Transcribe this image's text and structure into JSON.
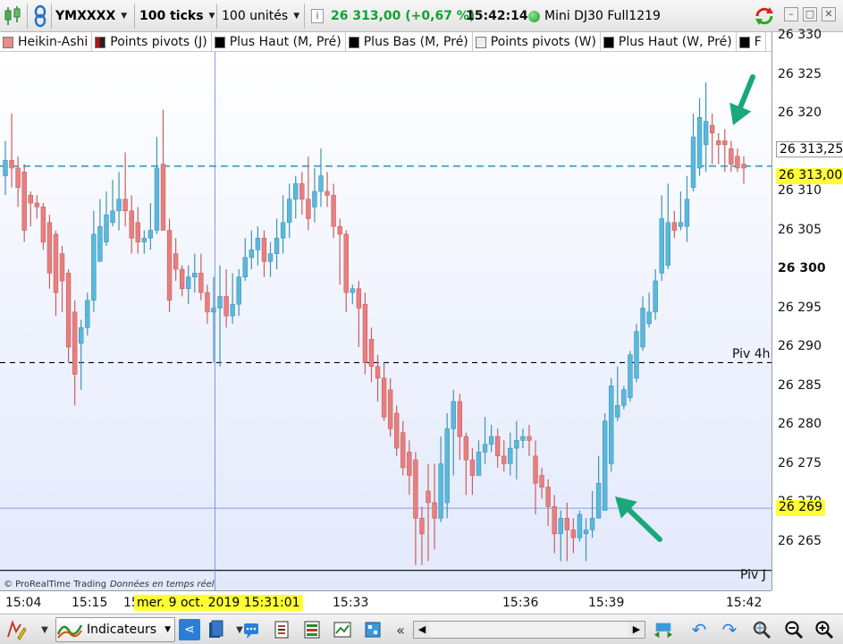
{
  "toolbar": {
    "symbol": "YMXXXX",
    "ticks": "100 ticks",
    "units": "100 unités",
    "price": "26 313,00",
    "change": "(+0,67 %)",
    "time": "15:42:14",
    "instrument": "Mini DJ30 Full1219"
  },
  "legend": [
    {
      "label": "Heikin-Ashi",
      "swatch": "#ea8a8a"
    },
    {
      "label": "Points pivots (J)",
      "swatch": "#222222"
    },
    {
      "label": "Plus Haut (M, Pré)",
      "swatch": "#000000"
    },
    {
      "label": "Plus Bas (M, Pré)",
      "swatch": "#000000"
    },
    {
      "label": "Points pivots (W)",
      "swatch": "#eeeeee"
    },
    {
      "label": "Plus Haut (W, Pré)",
      "swatch": "#000000"
    },
    {
      "label": "F",
      "swatch": "#000000"
    }
  ],
  "price_axis": {
    "ticks": [
      "26 330",
      "26 325",
      "26 320",
      "26 315",
      "26 310",
      "26 305",
      "26 300",
      "26 295",
      "26 290",
      "26 285",
      "26 280",
      "26 275",
      "26 270",
      "26 265"
    ],
    "bold_tick": "26 300",
    "last_price_label": "26 313,00",
    "ref_price_label": "26 313,25",
    "cursor_price_label": "26 269"
  },
  "time_axis": {
    "ticks": [
      "15:04",
      "15:15",
      "15",
      "15:33",
      "15:36",
      "15:39",
      "15:42"
    ],
    "cursor_label": "mer. 9 oct. 2019 15:31:01"
  },
  "pivot_labels": [
    "Piv 4h",
    "Piv J"
  ],
  "credit": {
    "source": "© ProRealTime Trading",
    "note": "Données en temps réel"
  },
  "bottombar": {
    "indicators_label": "Indicateurs"
  },
  "colors": {
    "up": "#5bb8dc",
    "down": "#e87f7f",
    "last_price_line": "#2a9bc8",
    "cursor_line": "#6a82e0",
    "arrow": "#1aa87a",
    "price_badge": "#ffff33"
  },
  "chart_data": {
    "type": "candlestick",
    "ylim": [
      26261,
      26331.5
    ],
    "reference_lines": [
      {
        "label": "",
        "value": 26313.25,
        "style": "dashed",
        "color": "#2a9bc8"
      },
      {
        "label": "Piv 4h",
        "value": 26288,
        "style": "dashed",
        "color": "#000000"
      },
      {
        "label": "Piv J",
        "value": 26261.3,
        "style": "solid",
        "color": "#000000"
      }
    ],
    "candles": [
      {
        "o": 26312.0,
        "h": 26316.5,
        "l": 26309.5,
        "c": 26314.0
      },
      {
        "o": 26314.0,
        "h": 26320.0,
        "l": 26310.5,
        "c": 26313.0
      },
      {
        "o": 26313.0,
        "h": 26314.5,
        "l": 26308.0,
        "c": 26310.5
      },
      {
        "o": 26312.5,
        "h": 26313.5,
        "l": 26303.5,
        "c": 26305.0
      },
      {
        "o": 26309.5,
        "h": 26310.0,
        "l": 26305.5,
        "c": 26308.5
      },
      {
        "o": 26308.5,
        "h": 26309.5,
        "l": 26306.5,
        "c": 26308.0
      },
      {
        "o": 26308.0,
        "h": 26308.5,
        "l": 26302.5,
        "c": 26303.5
      },
      {
        "o": 26306.0,
        "h": 26307.0,
        "l": 26297.5,
        "c": 26299.5
      },
      {
        "o": 26304.5,
        "h": 26305.0,
        "l": 26294.0,
        "c": 26297.0
      },
      {
        "o": 26302.0,
        "h": 26303.0,
        "l": 26294.5,
        "c": 26298.5
      },
      {
        "o": 26299.5,
        "h": 26300.0,
        "l": 26288.0,
        "c": 26290.0
      },
      {
        "o": 26294.5,
        "h": 26296.0,
        "l": 26282.5,
        "c": 26286.5
      },
      {
        "o": 26290.5,
        "h": 26293.5,
        "l": 26284.5,
        "c": 26292.5
      },
      {
        "o": 26292.5,
        "h": 26297.0,
        "l": 26291.5,
        "c": 26296.0
      },
      {
        "o": 26296.0,
        "h": 26307.5,
        "l": 26294.5,
        "c": 26304.5
      },
      {
        "o": 26301.0,
        "h": 26309.0,
        "l": 26301.0,
        "c": 26305.5
      },
      {
        "o": 26303.5,
        "h": 26310.0,
        "l": 26303.0,
        "c": 26307.0
      },
      {
        "o": 26306.0,
        "h": 26311.5,
        "l": 26305.5,
        "c": 26307.5
      },
      {
        "o": 26307.5,
        "h": 26312.5,
        "l": 26305.0,
        "c": 26309.0
      },
      {
        "o": 26309.0,
        "h": 26315.0,
        "l": 26305.5,
        "c": 26307.5
      },
      {
        "o": 26307.5,
        "h": 26309.5,
        "l": 26302.0,
        "c": 26304.0
      },
      {
        "o": 26306.0,
        "h": 26308.0,
        "l": 26302.0,
        "c": 26303.5
      },
      {
        "o": 26303.5,
        "h": 26305.0,
        "l": 26302.0,
        "c": 26304.0
      },
      {
        "o": 26304.0,
        "h": 26308.5,
        "l": 26302.5,
        "c": 26305.0
      },
      {
        "o": 26305.0,
        "h": 26317.0,
        "l": 26304.5,
        "c": 26313.0
      },
      {
        "o": 26313.5,
        "h": 26320.5,
        "l": 26305.0,
        "c": 26305.0
      },
      {
        "o": 26305.0,
        "h": 26306.5,
        "l": 26294.5,
        "c": 26296.0
      },
      {
        "o": 26302.0,
        "h": 26304.0,
        "l": 26298.5,
        "c": 26300.0
      },
      {
        "o": 26300.0,
        "h": 26300.5,
        "l": 26296.5,
        "c": 26297.5
      },
      {
        "o": 26297.5,
        "h": 26300.5,
        "l": 26295.5,
        "c": 26299.0
      },
      {
        "o": 26299.0,
        "h": 26302.0,
        "l": 26297.0,
        "c": 26299.5
      },
      {
        "o": 26299.5,
        "h": 26302.0,
        "l": 26296.0,
        "c": 26297.0
      },
      {
        "o": 26297.0,
        "h": 26298.0,
        "l": 26293.0,
        "c": 26294.5
      },
      {
        "o": 26294.5,
        "h": 26299.0,
        "l": 26288.0,
        "c": 26295.0
      },
      {
        "o": 26295.0,
        "h": 26300.5,
        "l": 26287.5,
        "c": 26296.5
      },
      {
        "o": 26296.5,
        "h": 26300.0,
        "l": 26292.5,
        "c": 26294.0
      },
      {
        "o": 26294.0,
        "h": 26299.5,
        "l": 26293.0,
        "c": 26295.5
      },
      {
        "o": 26295.5,
        "h": 26300.0,
        "l": 26294.0,
        "c": 26299.0
      },
      {
        "o": 26299.0,
        "h": 26304.0,
        "l": 26298.5,
        "c": 26301.5
      },
      {
        "o": 26301.5,
        "h": 26305.0,
        "l": 26300.0,
        "c": 26302.5
      },
      {
        "o": 26302.5,
        "h": 26305.5,
        "l": 26300.5,
        "c": 26304.0
      },
      {
        "o": 26304.0,
        "h": 26305.0,
        "l": 26299.0,
        "c": 26301.0
      },
      {
        "o": 26301.0,
        "h": 26303.5,
        "l": 26299.0,
        "c": 26302.0
      },
      {
        "o": 26302.0,
        "h": 26306.5,
        "l": 26300.0,
        "c": 26304.0
      },
      {
        "o": 26304.0,
        "h": 26309.5,
        "l": 26302.0,
        "c": 26306.0
      },
      {
        "o": 26306.0,
        "h": 26311.0,
        "l": 26304.0,
        "c": 26309.0
      },
      {
        "o": 26309.0,
        "h": 26312.0,
        "l": 26306.5,
        "c": 26311.0
      },
      {
        "o": 26311.0,
        "h": 26312.5,
        "l": 26307.0,
        "c": 26309.0
      },
      {
        "o": 26309.0,
        "h": 26314.5,
        "l": 26305.0,
        "c": 26306.5
      },
      {
        "o": 26308.0,
        "h": 26313.0,
        "l": 26306.0,
        "c": 26310.0
      },
      {
        "o": 26310.0,
        "h": 26315.5,
        "l": 26308.0,
        "c": 26312.0
      },
      {
        "o": 26310.0,
        "h": 26312.5,
        "l": 26308.0,
        "c": 26309.5
      },
      {
        "o": 26309.5,
        "h": 26311.0,
        "l": 26304.0,
        "c": 26305.5
      },
      {
        "o": 26305.5,
        "h": 26306.5,
        "l": 26298.0,
        "c": 26304.5
      },
      {
        "o": 26304.5,
        "h": 26305.0,
        "l": 26294.5,
        "c": 26297.0
      },
      {
        "o": 26297.0,
        "h": 26298.0,
        "l": 26295.5,
        "c": 26297.5
      },
      {
        "o": 26297.5,
        "h": 26298.5,
        "l": 26290.0,
        "c": 26295.0
      },
      {
        "o": 26295.5,
        "h": 26297.0,
        "l": 26286.5,
        "c": 26288.0
      },
      {
        "o": 26291.0,
        "h": 26292.5,
        "l": 26285.5,
        "c": 26287.5
      },
      {
        "o": 26287.5,
        "h": 26289.0,
        "l": 26283.0,
        "c": 26286.0
      },
      {
        "o": 26286.0,
        "h": 26288.0,
        "l": 26280.5,
        "c": 26281.0
      },
      {
        "o": 26284.5,
        "h": 26286.0,
        "l": 26278.5,
        "c": 26279.5
      },
      {
        "o": 26281.5,
        "h": 26282.5,
        "l": 26276.0,
        "c": 26277.0
      },
      {
        "o": 26279.0,
        "h": 26280.5,
        "l": 26273.5,
        "c": 26274.5
      },
      {
        "o": 26276.5,
        "h": 26278.0,
        "l": 26271.0,
        "c": 26273.5
      },
      {
        "o": 26275.5,
        "h": 26276.5,
        "l": 26262.0,
        "c": 26268.0
      },
      {
        "o": 26268.0,
        "h": 26269.5,
        "l": 26262.0,
        "c": 26266.0
      },
      {
        "o": 26271.5,
        "h": 26275.0,
        "l": 26262.5,
        "c": 26270.0
      },
      {
        "o": 26270.0,
        "h": 26275.0,
        "l": 26264.0,
        "c": 26268.0
      },
      {
        "o": 26268.0,
        "h": 26278.5,
        "l": 26267.5,
        "c": 26275.0
      },
      {
        "o": 26270.0,
        "h": 26281.5,
        "l": 26268.0,
        "c": 26279.5
      },
      {
        "o": 26279.5,
        "h": 26284.5,
        "l": 26273.5,
        "c": 26283.0
      },
      {
        "o": 26283.0,
        "h": 26284.0,
        "l": 26275.5,
        "c": 26278.5
      },
      {
        "o": 26278.5,
        "h": 26279.0,
        "l": 26271.0,
        "c": 26275.5
      },
      {
        "o": 26275.5,
        "h": 26277.0,
        "l": 26271.0,
        "c": 26273.5
      },
      {
        "o": 26273.5,
        "h": 26278.0,
        "l": 26273.5,
        "c": 26276.5
      },
      {
        "o": 26276.5,
        "h": 26281.0,
        "l": 26275.0,
        "c": 26277.5
      },
      {
        "o": 26277.5,
        "h": 26280.0,
        "l": 26276.5,
        "c": 26278.5
      },
      {
        "o": 26278.5,
        "h": 26279.5,
        "l": 26274.5,
        "c": 26276.0
      },
      {
        "o": 26276.0,
        "h": 26278.0,
        "l": 26274.0,
        "c": 26275.0
      },
      {
        "o": 26275.0,
        "h": 26279.0,
        "l": 26273.5,
        "c": 26277.0
      },
      {
        "o": 26277.0,
        "h": 26280.5,
        "l": 26273.0,
        "c": 26278.0
      },
      {
        "o": 26278.0,
        "h": 26279.5,
        "l": 26277.0,
        "c": 26278.5
      },
      {
        "o": 26278.5,
        "h": 26280.0,
        "l": 26276.0,
        "c": 26278.0
      },
      {
        "o": 26276.0,
        "h": 26278.0,
        "l": 26268.5,
        "c": 26272.5
      },
      {
        "o": 26273.5,
        "h": 26274.5,
        "l": 26270.5,
        "c": 26272.0
      },
      {
        "o": 26272.0,
        "h": 26273.0,
        "l": 26267.0,
        "c": 26269.5
      },
      {
        "o": 26269.5,
        "h": 26271.0,
        "l": 26263.5,
        "c": 26266.0
      },
      {
        "o": 26266.0,
        "h": 26269.0,
        "l": 26262.5,
        "c": 26268.0
      },
      {
        "o": 26268.0,
        "h": 26270.0,
        "l": 26262.5,
        "c": 26266.5
      },
      {
        "o": 26266.5,
        "h": 26268.0,
        "l": 26263.5,
        "c": 26265.5
      },
      {
        "o": 26265.5,
        "h": 26269.0,
        "l": 26265.0,
        "c": 26268.5
      },
      {
        "o": 26266.0,
        "h": 26268.0,
        "l": 26262.5,
        "c": 26266.5
      },
      {
        "o": 26266.5,
        "h": 26271.5,
        "l": 26265.5,
        "c": 26268.0
      },
      {
        "o": 26268.0,
        "h": 26276.0,
        "l": 26268.0,
        "c": 26272.5
      },
      {
        "o": 26269.0,
        "h": 26281.5,
        "l": 26269.0,
        "c": 26280.5
      },
      {
        "o": 26275.0,
        "h": 26286.0,
        "l": 26274.0,
        "c": 26285.0
      },
      {
        "o": 26281.0,
        "h": 26287.5,
        "l": 26280.5,
        "c": 26282.5
      },
      {
        "o": 26282.5,
        "h": 26285.0,
        "l": 26282.0,
        "c": 26284.5
      },
      {
        "o": 26283.5,
        "h": 26289.5,
        "l": 26283.0,
        "c": 26289.0
      },
      {
        "o": 26286.0,
        "h": 26293.0,
        "l": 26285.5,
        "c": 26292.0
      },
      {
        "o": 26290.0,
        "h": 26296.5,
        "l": 26289.5,
        "c": 26295.0
      },
      {
        "o": 26293.0,
        "h": 26297.0,
        "l": 26292.5,
        "c": 26294.5
      },
      {
        "o": 26294.5,
        "h": 26300.0,
        "l": 26293.5,
        "c": 26298.5
      },
      {
        "o": 26299.5,
        "h": 26309.5,
        "l": 26298.5,
        "c": 26306.5
      },
      {
        "o": 26300.5,
        "h": 26311.0,
        "l": 26300.0,
        "c": 26306.0
      },
      {
        "o": 26306.0,
        "h": 26307.5,
        "l": 26304.0,
        "c": 26305.0
      },
      {
        "o": 26305.5,
        "h": 26310.0,
        "l": 26305.0,
        "c": 26306.0
      },
      {
        "o": 26305.5,
        "h": 26312.0,
        "l": 26303.5,
        "c": 26309.0
      },
      {
        "o": 26310.5,
        "h": 26320.0,
        "l": 26310.0,
        "c": 26317.0
      },
      {
        "o": 26313.0,
        "h": 26322.0,
        "l": 26312.0,
        "c": 26319.5
      },
      {
        "o": 26316.0,
        "h": 26324.0,
        "l": 26312.5,
        "c": 26319.0
      },
      {
        "o": 26318.5,
        "h": 26320.0,
        "l": 26313.5,
        "c": 26317.5
      },
      {
        "o": 26316.5,
        "h": 26317.5,
        "l": 26313.5,
        "c": 26316.0
      },
      {
        "o": 26316.5,
        "h": 26318.0,
        "l": 26312.5,
        "c": 26316.0
      },
      {
        "o": 26315.5,
        "h": 26316.5,
        "l": 26312.5,
        "c": 26313.5
      },
      {
        "o": 26314.5,
        "h": 26315.5,
        "l": 26312.5,
        "c": 26313.0
      },
      {
        "o": 26313.5,
        "h": 26314.5,
        "l": 26311.0,
        "c": 26313.0
      }
    ]
  }
}
